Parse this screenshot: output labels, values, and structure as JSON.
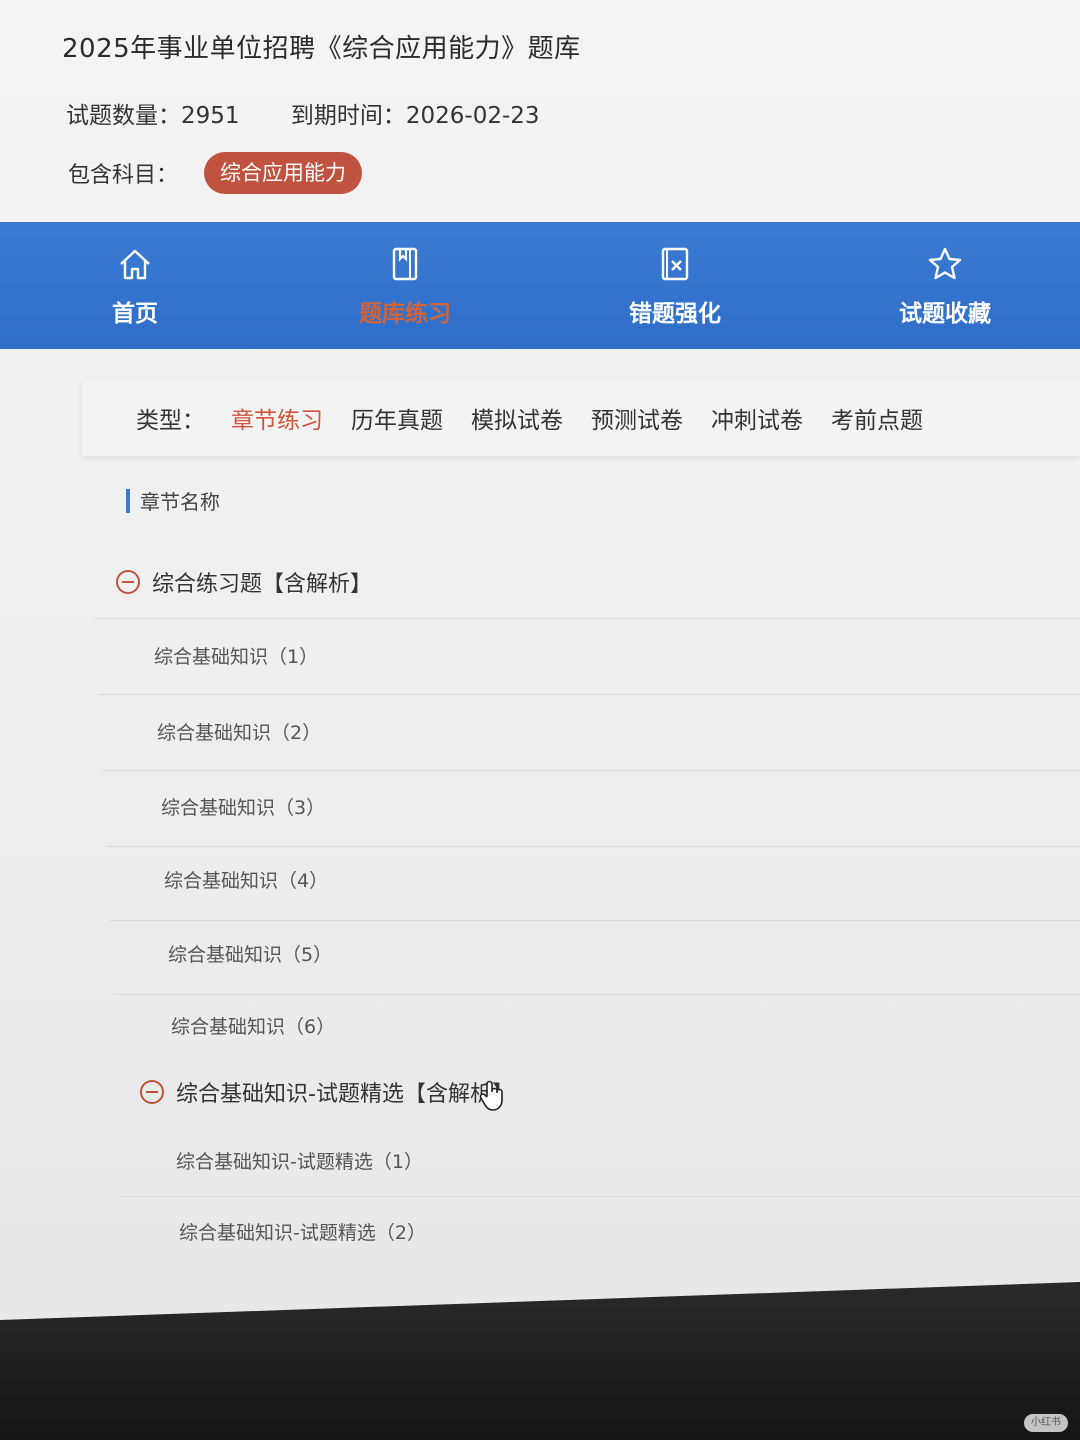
{
  "bank": {
    "title": "2025年事业单位招聘《综合应用能力》题库",
    "question_count": "试题数量：2951",
    "expire": "到期时间：2026-02-23",
    "subject_label": "包含科目：",
    "subject_tag": "综合应用能力"
  },
  "nav": {
    "items": [
      {
        "label": "首页",
        "icon": "home-icon"
      },
      {
        "label": "题库练习",
        "icon": "book-icon"
      },
      {
        "label": "错题强化",
        "icon": "wrong-question-icon"
      },
      {
        "label": "试题收藏",
        "icon": "star-icon"
      }
    ],
    "active_index": 1,
    "active_color": "#d0653c",
    "bar_color": "#2f6ec8"
  },
  "types": {
    "label": "类型：",
    "options": [
      "章节练习",
      "历年真题",
      "模拟试卷",
      "预测试卷",
      "冲刺试卷",
      "考前点题"
    ],
    "active_index": 0,
    "active_color": "#d0553c"
  },
  "chapters": {
    "header": "章节名称",
    "groups": [
      {
        "title": "综合练习题【含解析】",
        "items": [
          "综合基础知识（1）",
          "综合基础知识（2）",
          "综合基础知识（3）",
          "综合基础知识（4）",
          "综合基础知识（5）",
          "综合基础知识（6）"
        ]
      },
      {
        "title": "综合基础知识-试题精选【含解析】",
        "items": [
          "综合基础知识-试题精选（1）",
          "综合基础知识-试题精选（2）"
        ]
      }
    ]
  },
  "watermark": "小红书"
}
